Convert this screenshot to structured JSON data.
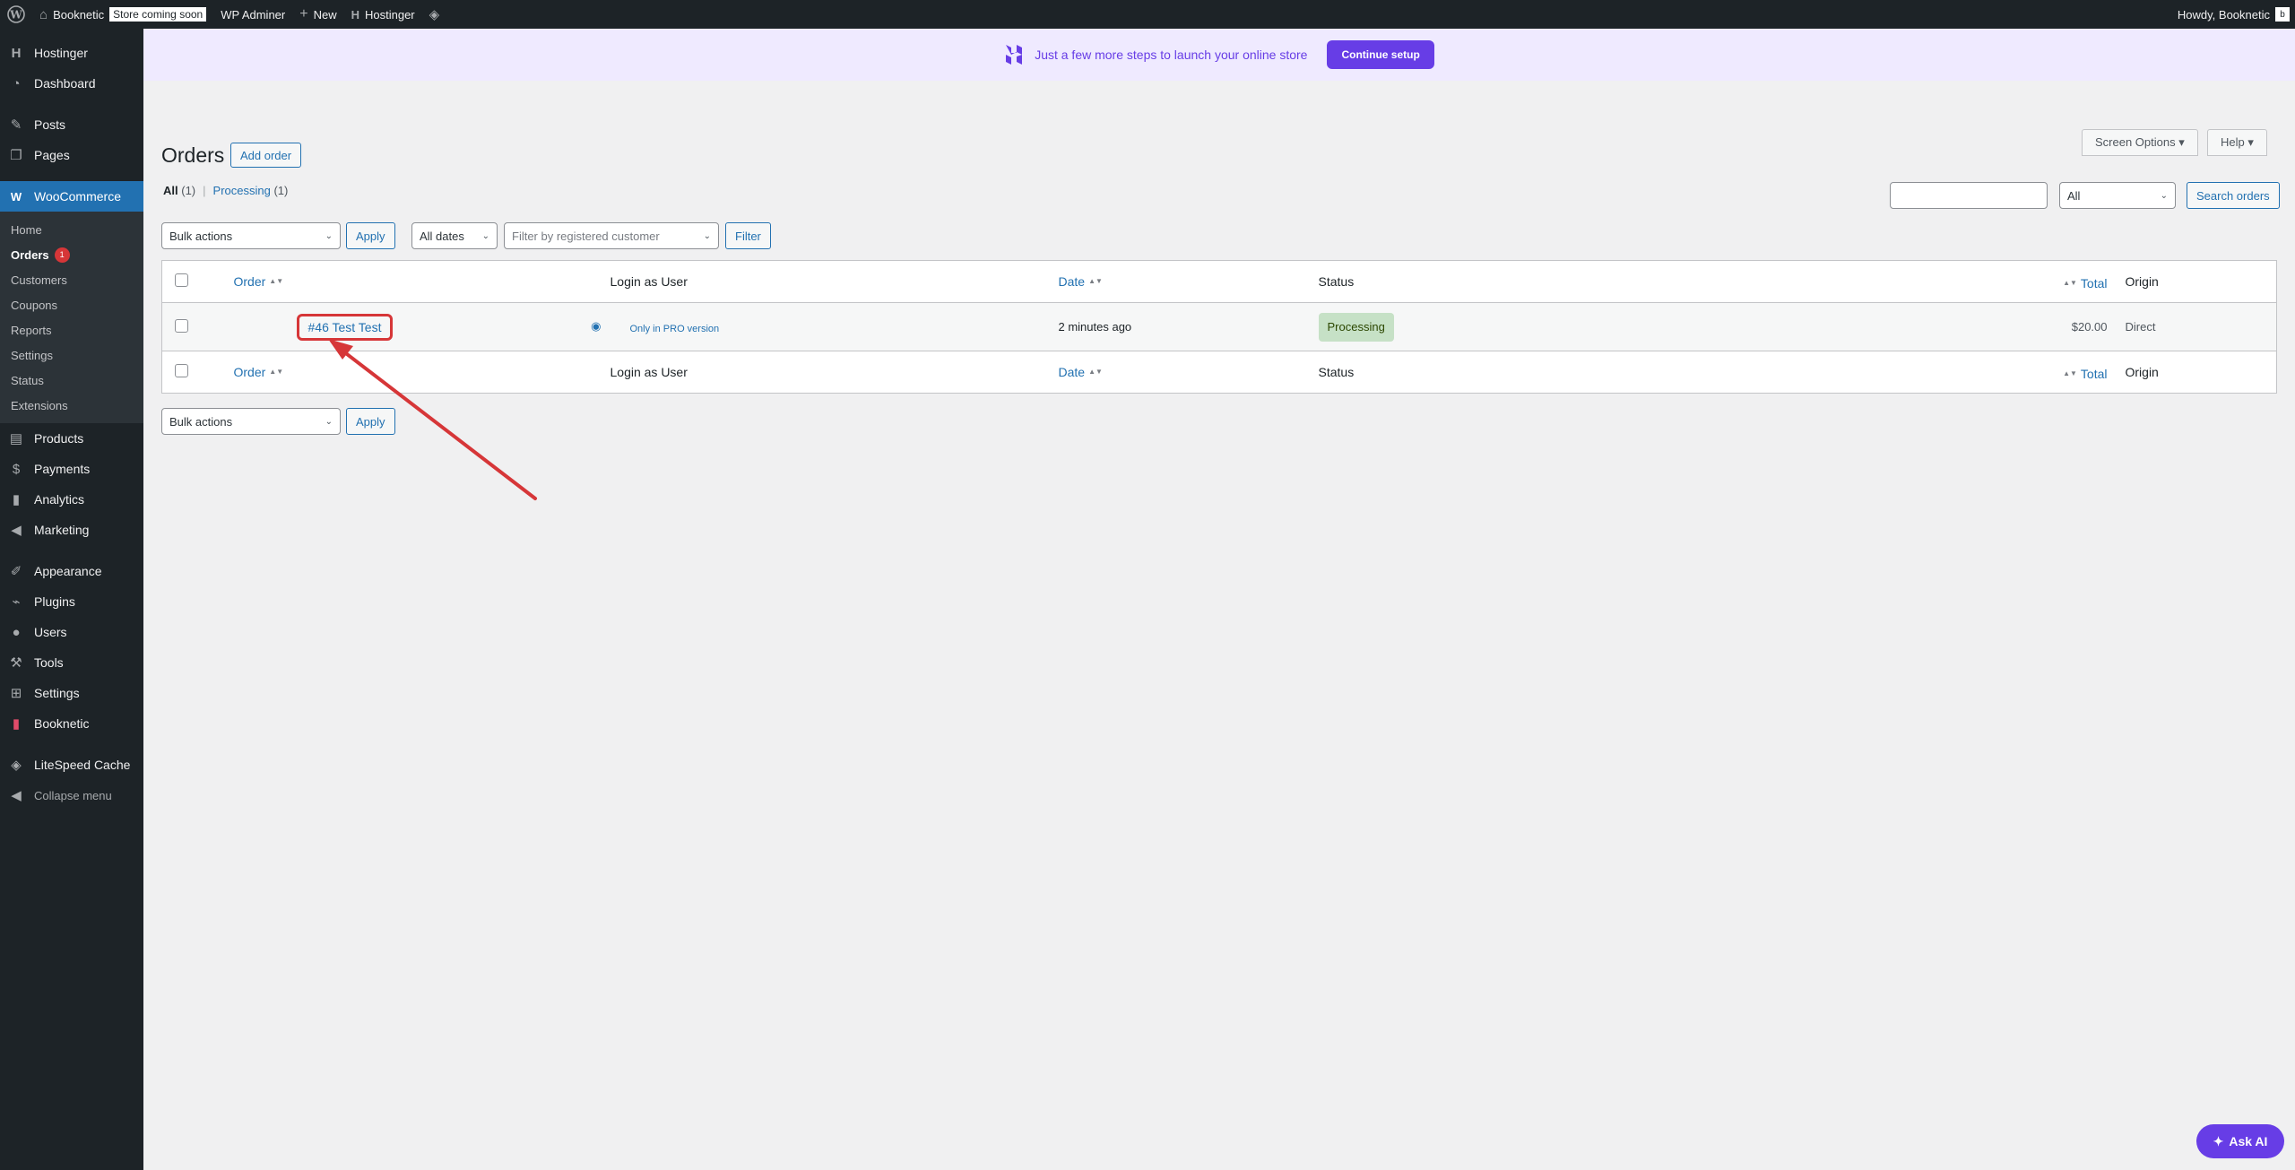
{
  "admin_bar": {
    "site_name": "Booknetic",
    "store_badge": "Store coming soon",
    "wp_adminer": "WP Adminer",
    "new_label": "New",
    "hostinger": "Hostinger",
    "greeting": "Howdy, Booknetic",
    "avatar_letter": "b"
  },
  "sidebar": {
    "items_top": [
      {
        "label": "Hostinger",
        "icon": "hostinger-icon"
      },
      {
        "label": "Dashboard",
        "icon": "dashboard-icon"
      }
    ],
    "items_content": [
      {
        "label": "Posts",
        "icon": "pin-icon"
      },
      {
        "label": "Pages",
        "icon": "pages-icon"
      }
    ],
    "woocommerce": {
      "label": "WooCommerce",
      "icon": "woocommerce-icon"
    },
    "woo_submenu": [
      {
        "label": "Home"
      },
      {
        "label": "Orders",
        "badge": "1"
      },
      {
        "label": "Customers"
      },
      {
        "label": "Coupons"
      },
      {
        "label": "Reports"
      },
      {
        "label": "Settings"
      },
      {
        "label": "Status"
      },
      {
        "label": "Extensions"
      }
    ],
    "items_store": [
      {
        "label": "Products",
        "icon": "products-icon"
      },
      {
        "label": "Payments",
        "icon": "payments-icon"
      },
      {
        "label": "Analytics",
        "icon": "analytics-icon"
      },
      {
        "label": "Marketing",
        "icon": "megaphone-icon"
      }
    ],
    "items_admin": [
      {
        "label": "Appearance",
        "icon": "brush-icon"
      },
      {
        "label": "Plugins",
        "icon": "plugin-icon"
      },
      {
        "label": "Users",
        "icon": "users-icon"
      },
      {
        "label": "Tools",
        "icon": "wrench-icon"
      },
      {
        "label": "Settings",
        "icon": "settings-icon"
      },
      {
        "label": "Booknetic",
        "icon": "booknetic-icon"
      }
    ],
    "litespeed": {
      "label": "LiteSpeed Cache",
      "icon": "litespeed-icon"
    },
    "collapse": {
      "label": "Collapse menu",
      "icon": "collapse-icon"
    }
  },
  "banner": {
    "message": "Just a few more steps to launch your online store",
    "cta": "Continue setup"
  },
  "page": {
    "title": "Orders",
    "add_order": "Add order",
    "screen_options": "Screen Options ▾",
    "help": "Help ▾",
    "filters": {
      "all_label": "All",
      "all_count": "(1)",
      "separator": "|",
      "processing_label": "Processing",
      "processing_count": "(1)"
    },
    "search": {
      "input_value": "",
      "scope": "All",
      "button": "Search orders"
    },
    "bulk_actions": "Bulk actions",
    "apply": "Apply",
    "all_dates": "All dates",
    "customer_placeholder": "Filter by registered customer",
    "filter": "Filter"
  },
  "table": {
    "columns": {
      "order": "Order",
      "login": "Login as User",
      "date": "Date",
      "status": "Status",
      "total": "Total",
      "origin": "Origin"
    },
    "rows": [
      {
        "order": "#46 Test Test",
        "login": "Only in PRO version",
        "date": "2 minutes ago",
        "status": "Processing",
        "total": "$20.00",
        "origin": "Direct"
      }
    ]
  },
  "ask_ai": "Ask AI",
  "colors": {
    "wp_blue": "#2271b1",
    "hostinger_purple": "#673de6",
    "annotation_red": "#d63638",
    "processing_green": "#c6e1c6"
  }
}
